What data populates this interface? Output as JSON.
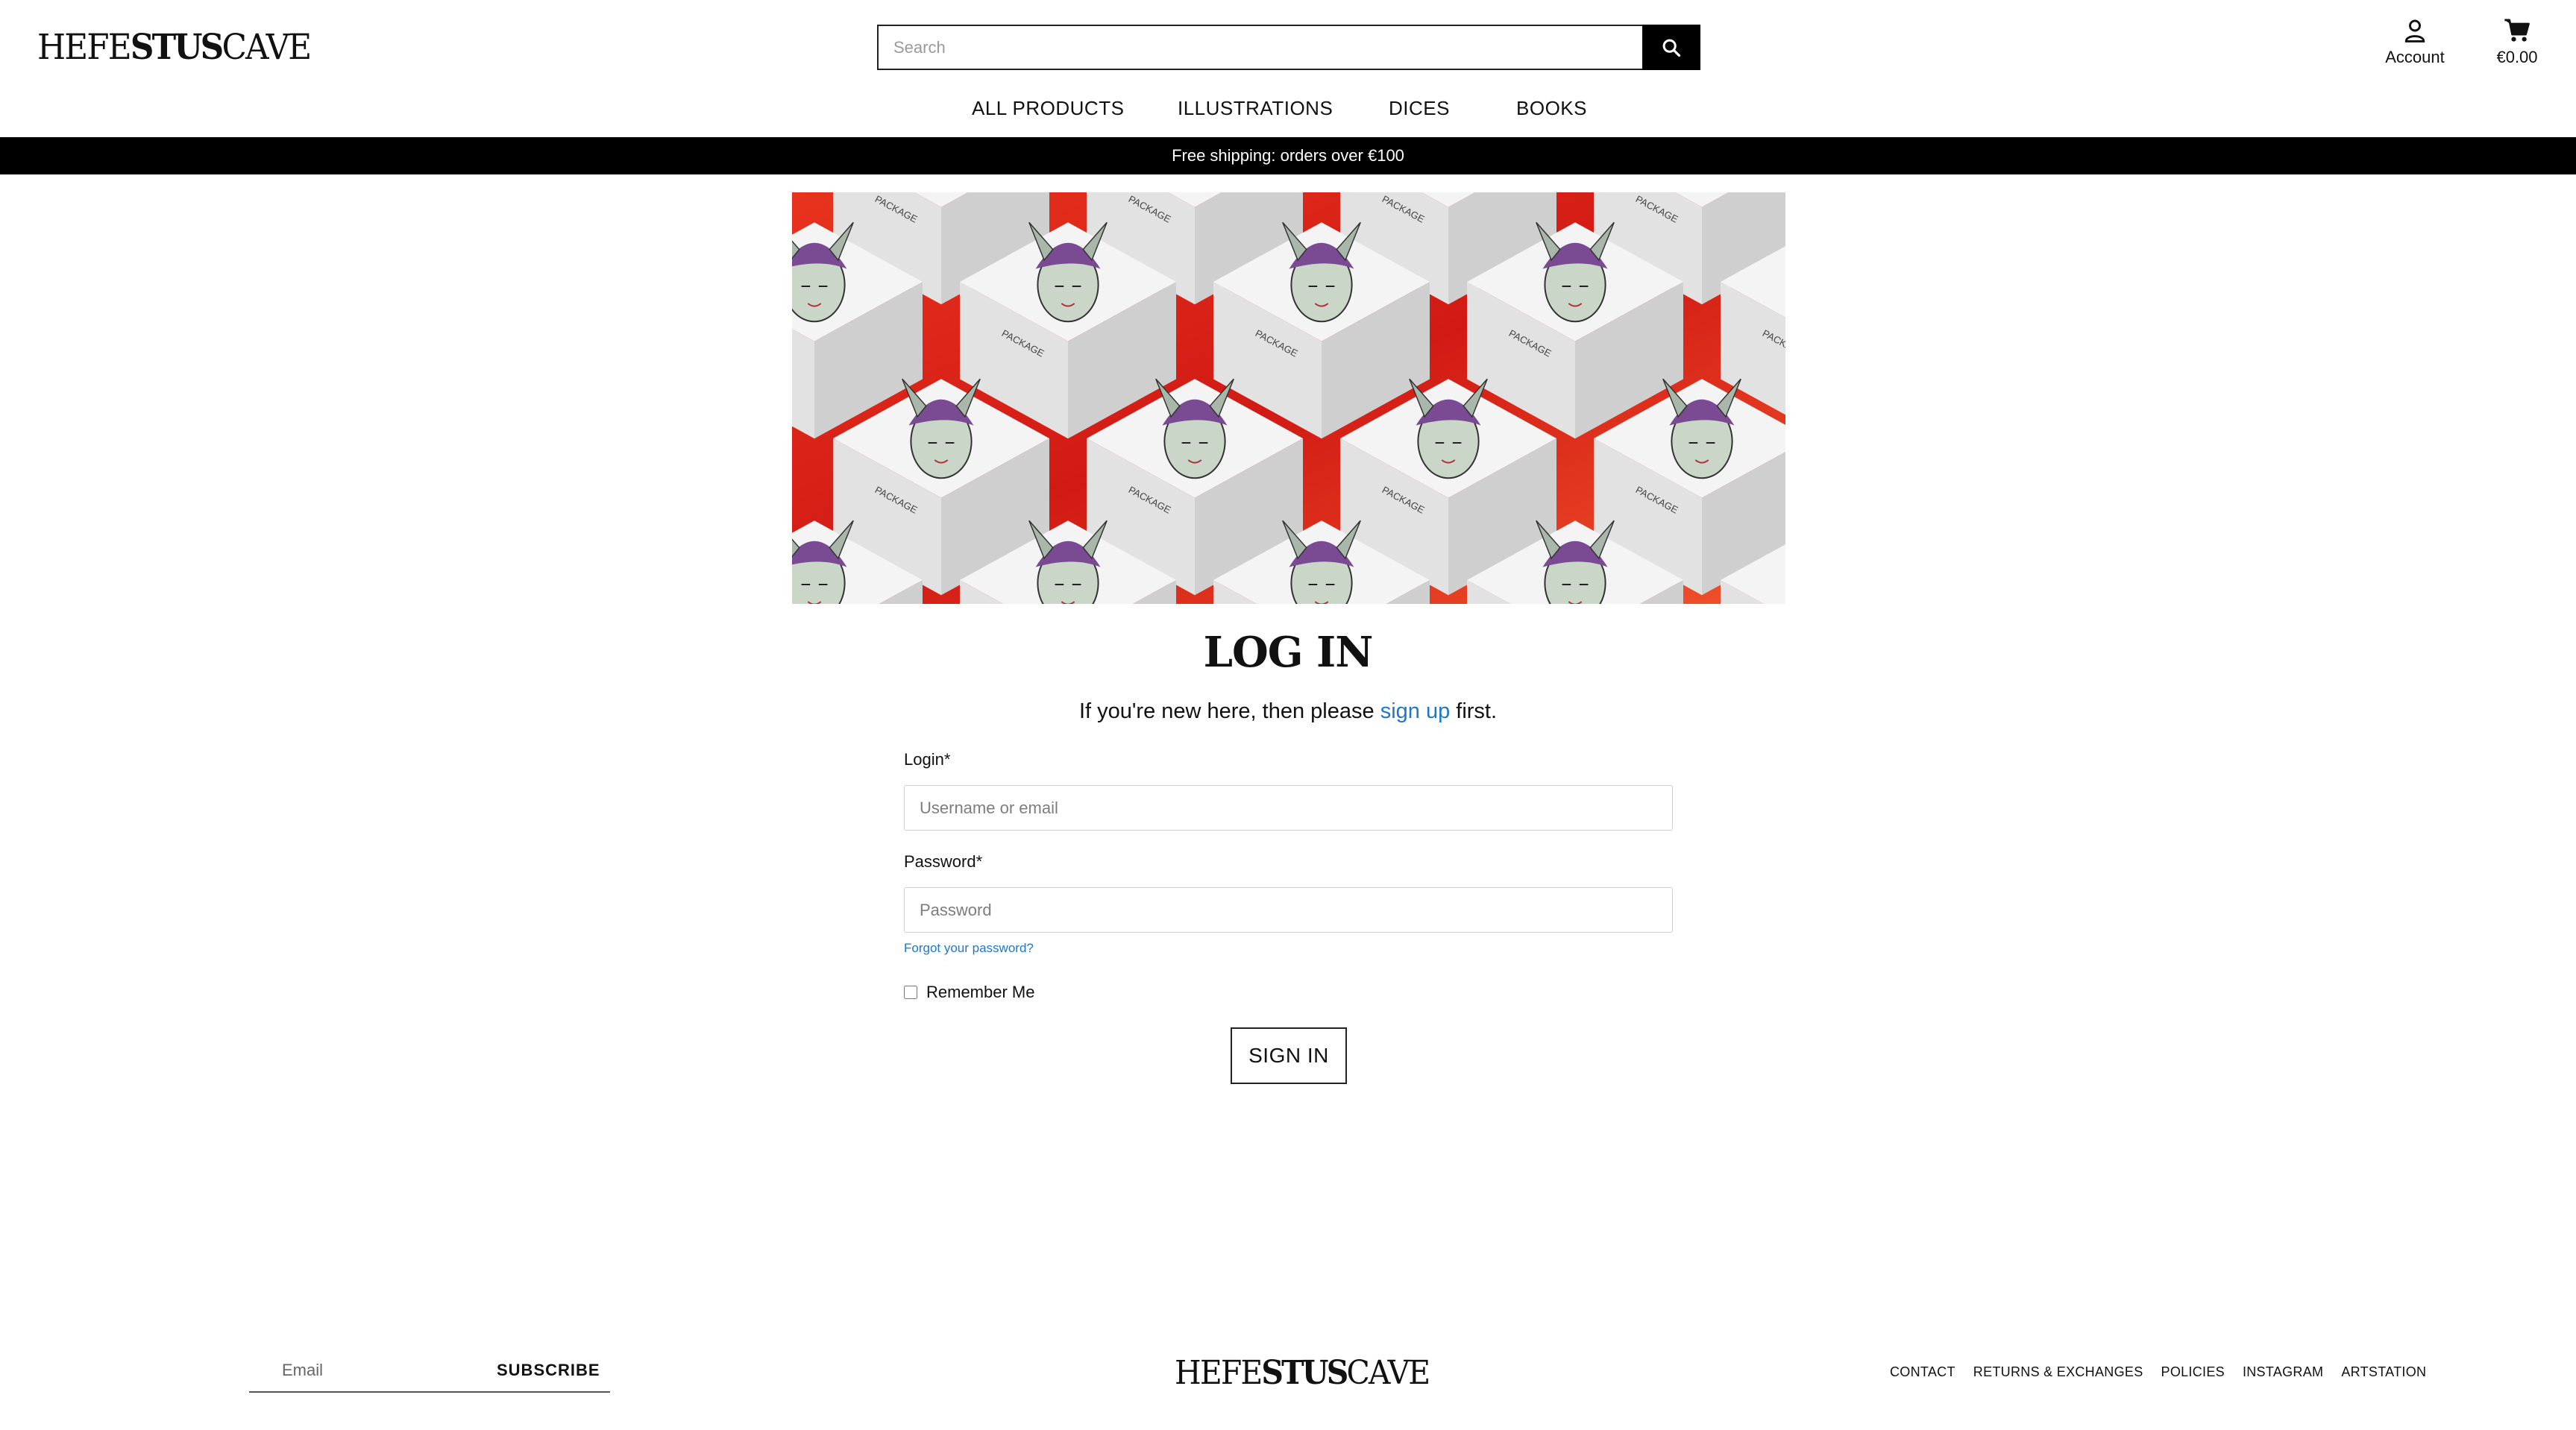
{
  "brand": {
    "logo_text_thin_a": "HEFE",
    "logo_text_bold": "STUS",
    "logo_text_thin_b": "CAVE"
  },
  "search": {
    "placeholder": "Search",
    "icon": "search-icon"
  },
  "account": {
    "label": "Account",
    "icon": "account-icon"
  },
  "cart": {
    "total": "€0.00",
    "icon": "cart-icon"
  },
  "nav": {
    "items": [
      {
        "label": "ALL PRODUCTS"
      },
      {
        "label": "ILLUSTRATIONS"
      },
      {
        "label": "DICES"
      },
      {
        "label": "BOOKS"
      }
    ]
  },
  "promo": {
    "text": "Free shipping: orders over €100"
  },
  "hero": {
    "box_text": "PACKAGE"
  },
  "login": {
    "title": "LOG IN",
    "intro_before": "If you're new here, then please ",
    "intro_link": "sign up",
    "intro_after": " first.",
    "login_label": "Login*",
    "login_placeholder": "Username or email",
    "password_label": "Password*",
    "password_placeholder": "Password",
    "forgot": "Forgot your password?",
    "remember": "Remember Me",
    "submit": "SIGN IN"
  },
  "footer": {
    "email_placeholder": "Email",
    "subscribe": "SUBSCRIBE",
    "links": [
      {
        "label": "CONTACT"
      },
      {
        "label": "RETURNS & EXCHANGES"
      },
      {
        "label": "POLICIES"
      },
      {
        "label": "INSTAGRAM"
      },
      {
        "label": "ARTSTATION"
      }
    ]
  },
  "colors": {
    "accent_link": "#1f77c9",
    "promo_bg": "#000000",
    "hero_red": "#d8241a"
  }
}
